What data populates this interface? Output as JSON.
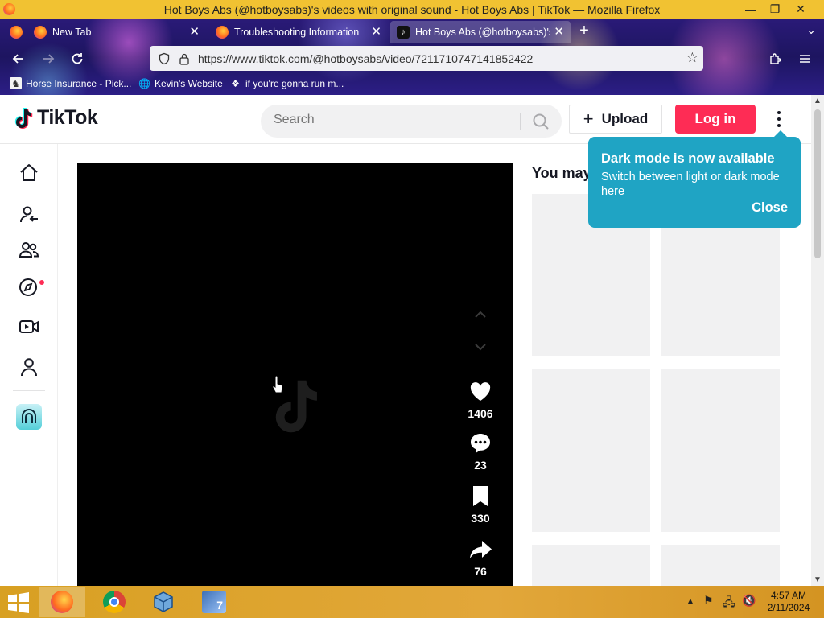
{
  "window": {
    "title": "Hot Boys Abs (@hotboysabs)'s videos with original sound - Hot Boys Abs | TikTok — Mozilla Firefox",
    "minimize": "—",
    "restore": "❐",
    "close": "✕"
  },
  "tabs": [
    {
      "label": "New Tab",
      "active": false
    },
    {
      "label": "Troubleshooting Information",
      "active": false
    },
    {
      "label": "Hot Boys Abs (@hotboysabs)'s",
      "active": true
    }
  ],
  "toolbar": {
    "url": "https://www.tiktok.com/@hotboysabs/video/7211710747141852422"
  },
  "bookmarks": [
    {
      "label": "Horse Insurance - Pick..."
    },
    {
      "label": "Kevin's Website"
    },
    {
      "label": "if you're gonna run m..."
    }
  ],
  "tiktok": {
    "brand": "TikTok",
    "search_placeholder": "Search",
    "upload_label": "Upload",
    "login_label": "Log in",
    "right_heading": "You may",
    "popover": {
      "title": "Dark mode is now available",
      "description": "Switch between light or dark mode here",
      "close_label": "Close"
    },
    "video": {
      "likes": "1406",
      "comments": "23",
      "saves": "330",
      "shares": "76"
    },
    "nav_items": [
      "home-icon",
      "following-icon",
      "friends-icon",
      "explore-icon",
      "live-icon",
      "profile-icon"
    ]
  },
  "taskbar": {
    "time": "4:57 AM",
    "date": "2/11/2024"
  },
  "colors": {
    "brand_red": "#fe2c55",
    "popover": "#1fa4c4",
    "taskbar": "#e2a73a"
  }
}
